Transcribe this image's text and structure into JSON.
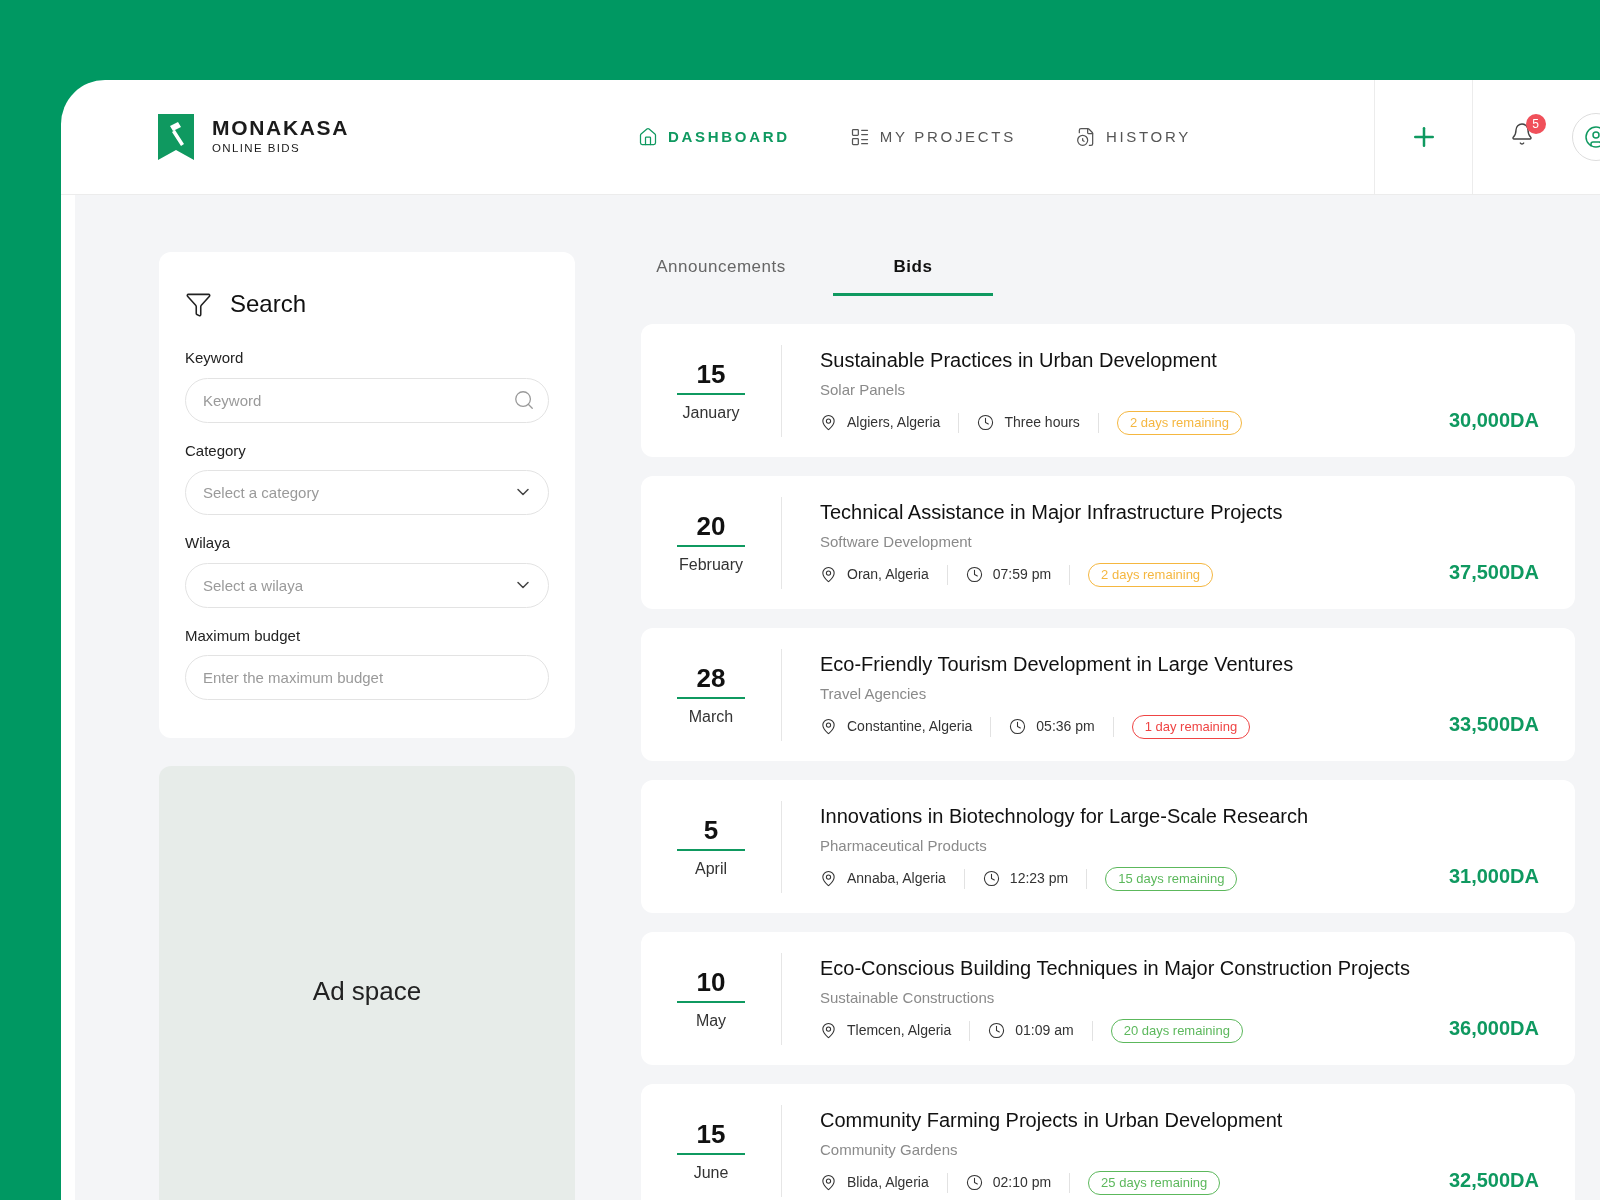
{
  "brand": {
    "name": "MONAKASA",
    "tagline": "ONLINE BIDS"
  },
  "nav": [
    {
      "label": "DASHBOARD",
      "selected": true
    },
    {
      "label": "MY PROJECTS",
      "selected": false
    },
    {
      "label": "HISTORY",
      "selected": false
    }
  ],
  "notifications": {
    "count": "5"
  },
  "search_panel": {
    "title": "Search",
    "fields": [
      {
        "label": "Keyword",
        "placeholder": "Keyword",
        "kind": "search"
      },
      {
        "label": "Category",
        "placeholder": "Select a category",
        "kind": "select"
      },
      {
        "label": "Wilaya",
        "placeholder": "Select a wilaya",
        "kind": "select"
      },
      {
        "label": "Maximum budget",
        "placeholder": "Enter the maximum budget",
        "kind": "text"
      }
    ]
  },
  "ad": {
    "label": "Ad space"
  },
  "tabs": [
    {
      "label": "Announcements",
      "selected": false
    },
    {
      "label": "Bids",
      "selected": true
    }
  ],
  "bids": [
    {
      "day": "15",
      "month": "January",
      "title": "Sustainable Practices in Urban Development",
      "category": "Solar Panels",
      "location": "Algiers, Algeria",
      "time": "Three hours",
      "remaining": "2 days remaining",
      "color": "#f5b740",
      "price": "30,000DA"
    },
    {
      "day": "20",
      "month": "February",
      "title": "Technical Assistance in Major Infrastructure Projects",
      "category": "Software Development",
      "location": "Oran, Algeria",
      "time": "07:59 pm",
      "remaining": "2 days remaining",
      "color": "#f5b740",
      "price": "37,500DA"
    },
    {
      "day": "28",
      "month": "March",
      "title": "Eco-Friendly Tourism Development in Large Ventures",
      "category": "Travel Agencies",
      "location": "Constantine, Algeria",
      "time": "05:36 pm",
      "remaining": "1 day remaining",
      "color": "#ef4444",
      "price": "33,500DA"
    },
    {
      "day": "5",
      "month": "April",
      "title": "Innovations in Biotechnology for Large-Scale Research",
      "category": "Pharmaceutical Products",
      "location": "Annaba, Algeria",
      "time": "12:23 pm",
      "remaining": "15 days remaining",
      "color": "#5cb85c",
      "price": "31,000DA"
    },
    {
      "day": "10",
      "month": "May",
      "title": "Eco-Conscious Building Techniques in Major Construction Projects",
      "category": "Sustainable Constructions",
      "location": "Tlemcen, Algeria",
      "time": "01:09 am",
      "remaining": "20 days remaining",
      "color": "#5cb85c",
      "price": "36,000DA"
    },
    {
      "day": "15",
      "month": "June",
      "title": "Community Farming Projects in Urban Development",
      "category": "Community Gardens",
      "location": "Blida, Algeria",
      "time": "02:10 pm",
      "remaining": "25 days remaining",
      "color": "#5cb85c",
      "price": "32,500DA"
    }
  ]
}
